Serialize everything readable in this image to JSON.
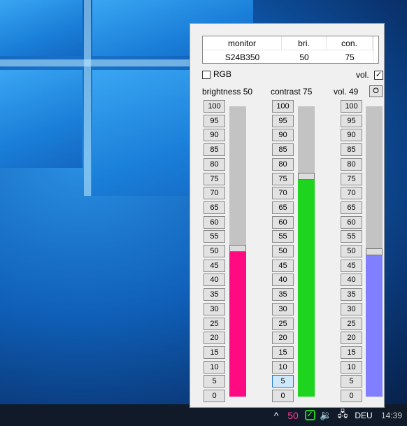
{
  "taskbar": {
    "chevron": "^",
    "tray_number": "50",
    "check": "✓",
    "volume_icon": "🔉",
    "network_icon": "🖧",
    "language": "DEU",
    "time": "14:39"
  },
  "panel": {
    "table": {
      "headers": [
        "monitor",
        "bri.",
        "con."
      ],
      "rows": [
        [
          "S24B350",
          "50",
          "75"
        ]
      ]
    },
    "rgb_label": "RGB",
    "rgb_checked": false,
    "vol_label": "vol.",
    "vol_checked": true,
    "vol_check_mark": "✓",
    "o_button": "O",
    "levels": [
      "100",
      "95",
      "90",
      "85",
      "80",
      "75",
      "70",
      "65",
      "60",
      "55",
      "50",
      "45",
      "40",
      "35",
      "30",
      "25",
      "20",
      "15",
      "10",
      "5",
      "0"
    ],
    "columns": [
      {
        "label": "brightness 50",
        "value": 50,
        "color": "#ff0a80",
        "active_level": null
      },
      {
        "label": "contrast 75",
        "value": 75,
        "color": "#1fd41f",
        "active_level": "5"
      },
      {
        "label": "vol. 49",
        "value": 49,
        "color": "#7f7fff",
        "active_level": null
      }
    ]
  }
}
